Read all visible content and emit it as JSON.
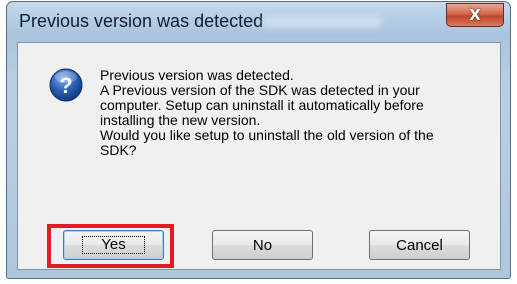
{
  "window": {
    "title": "Previous version was detected",
    "close_label": "X"
  },
  "dialog": {
    "icon": "question-icon",
    "message_lines": [
      "Previous version was detected.",
      "A Previous version of the SDK was detected in your",
      "computer. Setup can uninstall it automatically before",
      "installing the new version.",
      "Would you like setup to uninstall the old version of the",
      "SDK?"
    ]
  },
  "buttons": {
    "yes": "Yes",
    "no": "No",
    "cancel": "Cancel"
  },
  "colors": {
    "highlight": "#e01b24",
    "icon_blue": "#2a5fb4"
  }
}
